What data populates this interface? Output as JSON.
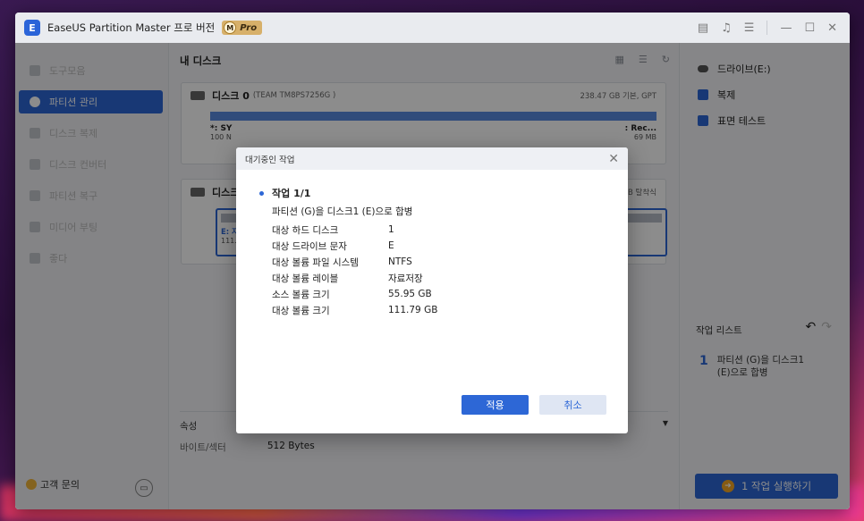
{
  "app": {
    "title": "EaseUS Partition Master 프로 버전",
    "badge_letter": "M",
    "badge_label": "Pro"
  },
  "sidebar": {
    "items": [
      {
        "label": "도구모음"
      },
      {
        "label": "파티션 관리"
      },
      {
        "label": "디스크 복제"
      },
      {
        "label": "디스크 컨버터"
      },
      {
        "label": "파티션 복구"
      },
      {
        "label": "미디어 부팅"
      },
      {
        "label": "좋다"
      }
    ],
    "support_label": "고객 문의"
  },
  "main": {
    "title": "내 디스크",
    "disk0": {
      "name": "디스크 0",
      "model": "(TEAM TM8PS7256G )",
      "info": "238.47 GB 기본, GPT",
      "left_label": "*: SY",
      "left_size": "100 N",
      "right_label": ": Rec...",
      "right_size": "69 MB"
    },
    "disk1": {
      "name": "디스크",
      "info": "GB 탈착식",
      "vol_label": "E: 자",
      "vol_size": "111.7"
    },
    "props_title": "속성",
    "props_key": "바이트/섹터",
    "props_value": "512 Bytes"
  },
  "right_panel": {
    "items": [
      {
        "label": "드라이브(E:)"
      },
      {
        "label": "복제"
      },
      {
        "label": "표면 테스트"
      }
    ],
    "queue_title": "작업 리스트",
    "queue_num": "1",
    "queue_text": "파티션 (G)을 디스크1 (E)으로 합병",
    "execute_label": "1 작업 실행하기"
  },
  "modal": {
    "header": "대기중인 작업",
    "task_title": "작업 1/1",
    "task_desc": "파티션 (G)을 디스크1 (E)으로 합병",
    "rows": [
      {
        "k": "대상 하드 디스크",
        "v": "1"
      },
      {
        "k": "대상 드라이브 문자",
        "v": "E"
      },
      {
        "k": "대상 볼륨 파일 시스템",
        "v": "NTFS"
      },
      {
        "k": "대상 볼륨 레이블",
        "v": "자료저장"
      },
      {
        "k": "소스 볼륨 크기",
        "v": "55.95 GB"
      },
      {
        "k": "대상 볼륨 크기",
        "v": "111.79 GB"
      }
    ],
    "apply_label": "적용",
    "cancel_label": "취소"
  }
}
